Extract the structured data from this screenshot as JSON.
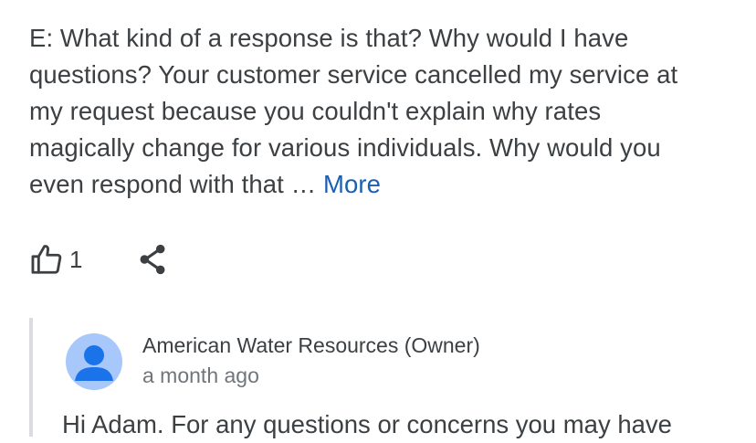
{
  "review": {
    "lines": [
      "E: What kind of a response is that? Why would I have",
      "questions? Your customer service cancelled my service at",
      "my request because you couldn't explain why rates",
      "magically change for various individuals. Why would you",
      "even respond with that …"
    ],
    "more_label": "More"
  },
  "actions": {
    "like_icon": "thumbs-up-icon",
    "like_count": "1",
    "share_icon": "share-icon"
  },
  "reply": {
    "avatar_icon": "default-avatar-icon",
    "owner_name": "American Water Resources (Owner)",
    "date": "a month ago",
    "text": "Hi Adam. For any questions or concerns you may have"
  },
  "colors": {
    "text": "#3c4043",
    "link": "#1a5fb4",
    "muted": "#70757a",
    "avatar_bg": "#a8c7fa",
    "avatar_fg": "#1a73e8",
    "divider": "#dadce0"
  }
}
